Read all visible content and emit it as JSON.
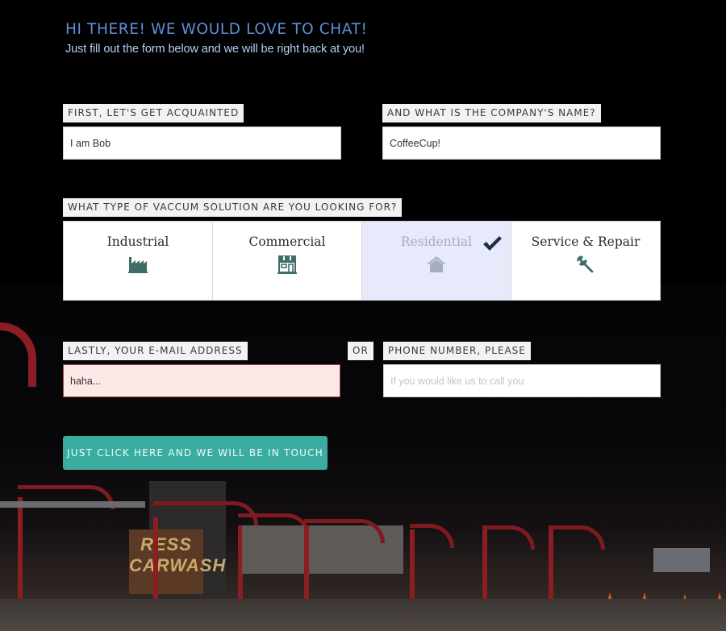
{
  "header": {
    "title": "HI THERE! WE WOULD LOVE TO CHAT!",
    "subtitle": "Just fill out the form below and we will be right back at you!"
  },
  "form": {
    "name": {
      "label": "FIRST, LET'S GET ACQUAINTED",
      "value": "I am Bob"
    },
    "company": {
      "label": "AND WHAT IS THE COMPANY'S NAME?",
      "value": "CoffeeCup!"
    },
    "solution": {
      "label": "WHAT TYPE OF VACCUM SOLUTION ARE YOU LOOKING FOR?",
      "options": [
        {
          "label": "Industrial",
          "icon": "factory-icon",
          "selected": false
        },
        {
          "label": "Commercial",
          "icon": "storefront-icon",
          "selected": false
        },
        {
          "label": "Residential",
          "icon": "house-icon",
          "selected": true
        },
        {
          "label": "Service & Repair",
          "icon": "wrench-icon",
          "selected": false
        }
      ],
      "selected_indicator": "checkmark-icon"
    },
    "email": {
      "label": "LASTLY, YOUR E-MAIL ADDRESS",
      "value": "haha...",
      "state": "error"
    },
    "or_label": "OR",
    "phone": {
      "label": "PHONE NUMBER, PLEASE",
      "value": "",
      "placeholder": "If you would like us to call you"
    },
    "submit_label": "JUST CLICK HERE AND WE WILL BE IN TOUCH"
  },
  "colors": {
    "heading": "#5f8fd8",
    "subheading": "#b8cdf4",
    "icon": "#3f6e68",
    "selected_card_bg": "#e8e9fb",
    "checkmark": "#1d2f45",
    "submit_bg": "#3aada0",
    "error_bg": "#fde8e8",
    "error_border": "#b2403e"
  }
}
